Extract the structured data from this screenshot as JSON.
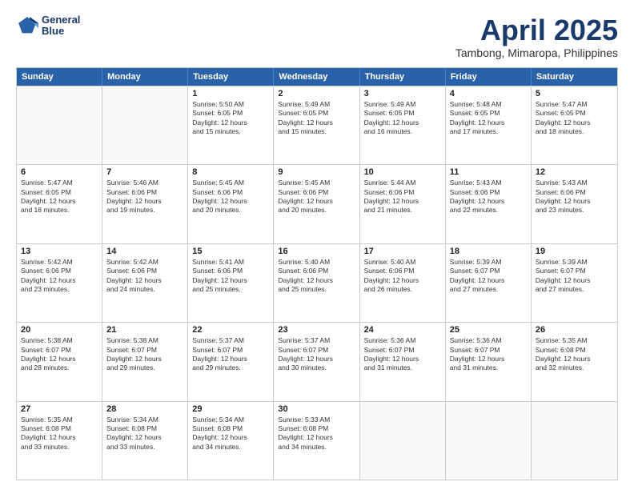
{
  "header": {
    "logo_line1": "General",
    "logo_line2": "Blue",
    "month": "April 2025",
    "location": "Tambong, Mimaropa, Philippines"
  },
  "days_of_week": [
    "Sunday",
    "Monday",
    "Tuesday",
    "Wednesday",
    "Thursday",
    "Friday",
    "Saturday"
  ],
  "rows": [
    [
      {
        "day": "",
        "info": []
      },
      {
        "day": "",
        "info": []
      },
      {
        "day": "1",
        "info": [
          "Sunrise: 5:50 AM",
          "Sunset: 6:05 PM",
          "Daylight: 12 hours",
          "and 15 minutes."
        ]
      },
      {
        "day": "2",
        "info": [
          "Sunrise: 5:49 AM",
          "Sunset: 6:05 PM",
          "Daylight: 12 hours",
          "and 15 minutes."
        ]
      },
      {
        "day": "3",
        "info": [
          "Sunrise: 5:49 AM",
          "Sunset: 6:05 PM",
          "Daylight: 12 hours",
          "and 16 minutes."
        ]
      },
      {
        "day": "4",
        "info": [
          "Sunrise: 5:48 AM",
          "Sunset: 6:05 PM",
          "Daylight: 12 hours",
          "and 17 minutes."
        ]
      },
      {
        "day": "5",
        "info": [
          "Sunrise: 5:47 AM",
          "Sunset: 6:05 PM",
          "Daylight: 12 hours",
          "and 18 minutes."
        ]
      }
    ],
    [
      {
        "day": "6",
        "info": [
          "Sunrise: 5:47 AM",
          "Sunset: 6:05 PM",
          "Daylight: 12 hours",
          "and 18 minutes."
        ]
      },
      {
        "day": "7",
        "info": [
          "Sunrise: 5:46 AM",
          "Sunset: 6:06 PM",
          "Daylight: 12 hours",
          "and 19 minutes."
        ]
      },
      {
        "day": "8",
        "info": [
          "Sunrise: 5:45 AM",
          "Sunset: 6:06 PM",
          "Daylight: 12 hours",
          "and 20 minutes."
        ]
      },
      {
        "day": "9",
        "info": [
          "Sunrise: 5:45 AM",
          "Sunset: 6:06 PM",
          "Daylight: 12 hours",
          "and 20 minutes."
        ]
      },
      {
        "day": "10",
        "info": [
          "Sunrise: 5:44 AM",
          "Sunset: 6:06 PM",
          "Daylight: 12 hours",
          "and 21 minutes."
        ]
      },
      {
        "day": "11",
        "info": [
          "Sunrise: 5:43 AM",
          "Sunset: 6:06 PM",
          "Daylight: 12 hours",
          "and 22 minutes."
        ]
      },
      {
        "day": "12",
        "info": [
          "Sunrise: 5:43 AM",
          "Sunset: 6:06 PM",
          "Daylight: 12 hours",
          "and 23 minutes."
        ]
      }
    ],
    [
      {
        "day": "13",
        "info": [
          "Sunrise: 5:42 AM",
          "Sunset: 6:06 PM",
          "Daylight: 12 hours",
          "and 23 minutes."
        ]
      },
      {
        "day": "14",
        "info": [
          "Sunrise: 5:42 AM",
          "Sunset: 6:06 PM",
          "Daylight: 12 hours",
          "and 24 minutes."
        ]
      },
      {
        "day": "15",
        "info": [
          "Sunrise: 5:41 AM",
          "Sunset: 6:06 PM",
          "Daylight: 12 hours",
          "and 25 minutes."
        ]
      },
      {
        "day": "16",
        "info": [
          "Sunrise: 5:40 AM",
          "Sunset: 6:06 PM",
          "Daylight: 12 hours",
          "and 25 minutes."
        ]
      },
      {
        "day": "17",
        "info": [
          "Sunrise: 5:40 AM",
          "Sunset: 6:06 PM",
          "Daylight: 12 hours",
          "and 26 minutes."
        ]
      },
      {
        "day": "18",
        "info": [
          "Sunrise: 5:39 AM",
          "Sunset: 6:07 PM",
          "Daylight: 12 hours",
          "and 27 minutes."
        ]
      },
      {
        "day": "19",
        "info": [
          "Sunrise: 5:39 AM",
          "Sunset: 6:07 PM",
          "Daylight: 12 hours",
          "and 27 minutes."
        ]
      }
    ],
    [
      {
        "day": "20",
        "info": [
          "Sunrise: 5:38 AM",
          "Sunset: 6:07 PM",
          "Daylight: 12 hours",
          "and 28 minutes."
        ]
      },
      {
        "day": "21",
        "info": [
          "Sunrise: 5:38 AM",
          "Sunset: 6:07 PM",
          "Daylight: 12 hours",
          "and 29 minutes."
        ]
      },
      {
        "day": "22",
        "info": [
          "Sunrise: 5:37 AM",
          "Sunset: 6:07 PM",
          "Daylight: 12 hours",
          "and 29 minutes."
        ]
      },
      {
        "day": "23",
        "info": [
          "Sunrise: 5:37 AM",
          "Sunset: 6:07 PM",
          "Daylight: 12 hours",
          "and 30 minutes."
        ]
      },
      {
        "day": "24",
        "info": [
          "Sunrise: 5:36 AM",
          "Sunset: 6:07 PM",
          "Daylight: 12 hours",
          "and 31 minutes."
        ]
      },
      {
        "day": "25",
        "info": [
          "Sunrise: 5:36 AM",
          "Sunset: 6:07 PM",
          "Daylight: 12 hours",
          "and 31 minutes."
        ]
      },
      {
        "day": "26",
        "info": [
          "Sunrise: 5:35 AM",
          "Sunset: 6:08 PM",
          "Daylight: 12 hours",
          "and 32 minutes."
        ]
      }
    ],
    [
      {
        "day": "27",
        "info": [
          "Sunrise: 5:35 AM",
          "Sunset: 6:08 PM",
          "Daylight: 12 hours",
          "and 33 minutes."
        ]
      },
      {
        "day": "28",
        "info": [
          "Sunrise: 5:34 AM",
          "Sunset: 6:08 PM",
          "Daylight: 12 hours",
          "and 33 minutes."
        ]
      },
      {
        "day": "29",
        "info": [
          "Sunrise: 5:34 AM",
          "Sunset: 6:08 PM",
          "Daylight: 12 hours",
          "and 34 minutes."
        ]
      },
      {
        "day": "30",
        "info": [
          "Sunrise: 5:33 AM",
          "Sunset: 6:08 PM",
          "Daylight: 12 hours",
          "and 34 minutes."
        ]
      },
      {
        "day": "",
        "info": []
      },
      {
        "day": "",
        "info": []
      },
      {
        "day": "",
        "info": []
      }
    ]
  ]
}
